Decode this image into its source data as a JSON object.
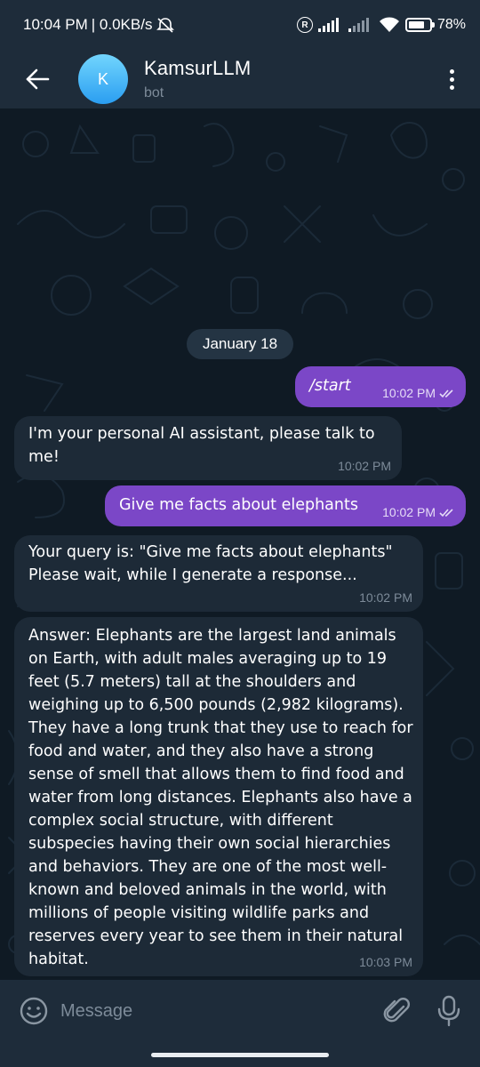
{
  "status_bar": {
    "time": "10:04 PM",
    "network_speed": "| 0.0KB/s",
    "battery": "78%"
  },
  "header": {
    "back_icon": "arrow-left-icon",
    "avatar_letter": "K",
    "title": "KamsurLLM",
    "subtitle": "bot",
    "menu_icon": "more-vertical-icon"
  },
  "chat": {
    "date": "January 18",
    "messages": [
      {
        "direction": "out",
        "text": "/start",
        "time": "10:02 PM",
        "status": "read"
      },
      {
        "direction": "in",
        "text": "I'm your personal AI assistant, please talk to me!",
        "time": "10:02 PM"
      },
      {
        "direction": "out",
        "text": "Give me facts about elephants",
        "time": "10:02 PM",
        "status": "read"
      },
      {
        "direction": "in",
        "text": "Your query is: \"Give me facts about elephants\"\nPlease wait, while I generate a response...",
        "time": "10:02 PM"
      },
      {
        "direction": "in",
        "text": "Answer: Elephants are the largest land animals on Earth, with adult males averaging up to 19 feet (5.7 meters) tall at the shoulders and weighing up to 6,500 pounds (2,982 kilograms). They have a long trunk that they use to reach for food and water, and they also have a strong sense of smell that allows them to find food and water from long distances. Elephants also have a complex social structure, with different subspecies having their own social hierarchies and behaviors. They are one of the most well-known and beloved animals in the world, with millions of people visiting wildlife parks and reserves every year to see them in their natural habitat.",
        "time": "10:03 PM"
      }
    ]
  },
  "input": {
    "placeholder": "Message",
    "emoji_icon": "smile-icon",
    "attach_icon": "paperclip-icon",
    "mic_icon": "microphone-icon"
  },
  "colors": {
    "background": "#0e1621",
    "header": "#1e2c3a",
    "outgoing_bubble": "#7b47c7",
    "incoming_bubble": "#1d2a37",
    "avatar_gradient_top": "#72d5fd",
    "avatar_gradient_bottom": "#2a9ef1"
  }
}
